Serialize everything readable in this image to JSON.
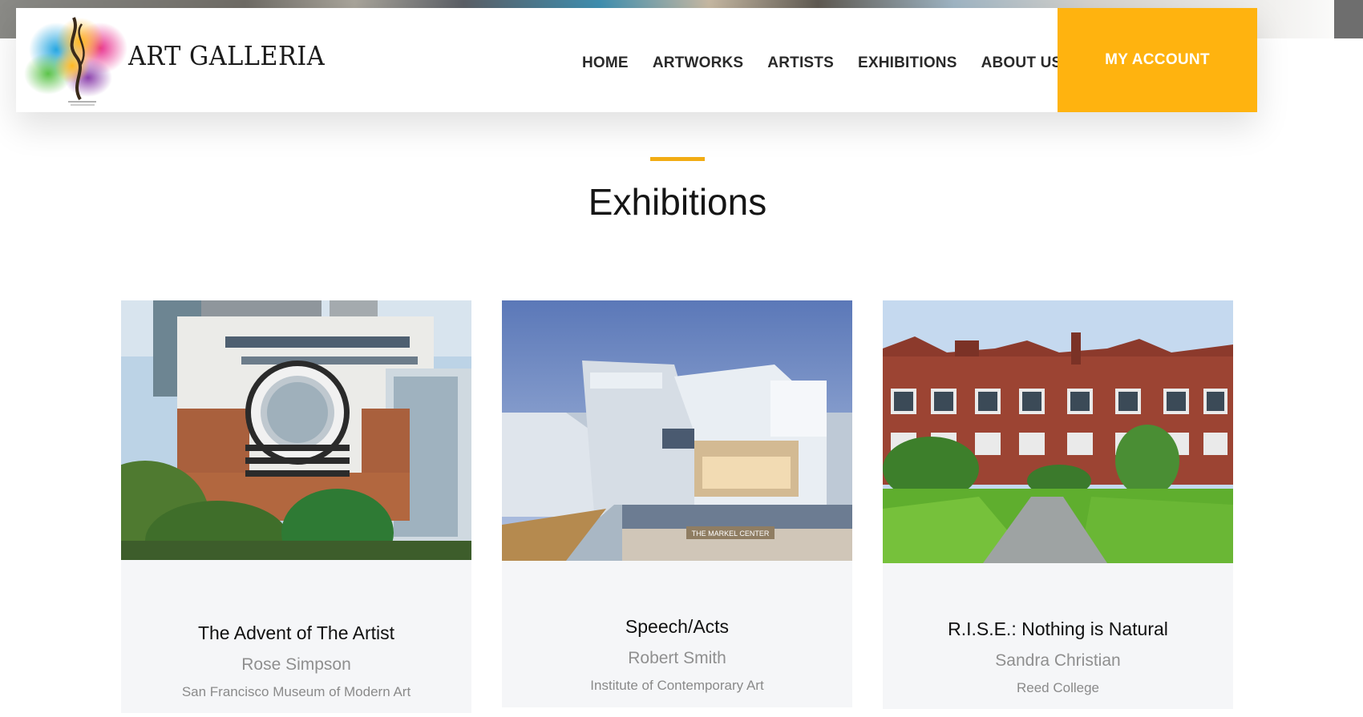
{
  "brand": {
    "name": "ART GALLERIA",
    "logo_icon": "watercolor-brush-logo"
  },
  "nav": {
    "links": [
      "HOME",
      "ARTWORKS",
      "ARTISTS",
      "EXHIBITIONS",
      "ABOUT US"
    ],
    "account_label": "MY ACCOUNT",
    "accent_color": "#ffb30f"
  },
  "section": {
    "title": "Exhibitions",
    "accent_color": "#f2ac13"
  },
  "exhibitions": [
    {
      "title": "The Advent of The Artist",
      "artist": "Rose Simpson",
      "venue": "San Francisco Museum of Modern Art",
      "image": "sfmoma-building-photo"
    },
    {
      "title": "Speech/Acts",
      "artist": "Robert Smith",
      "venue": "Institute of Contemporary Art",
      "image": "markel-center-building-photo",
      "image_caption": "THE MARKEL CENTER"
    },
    {
      "title": "R.I.S.E.: Nothing is Natural",
      "artist": "Sandra Christian",
      "venue": "Reed College",
      "image": "reed-college-building-photo"
    }
  ]
}
